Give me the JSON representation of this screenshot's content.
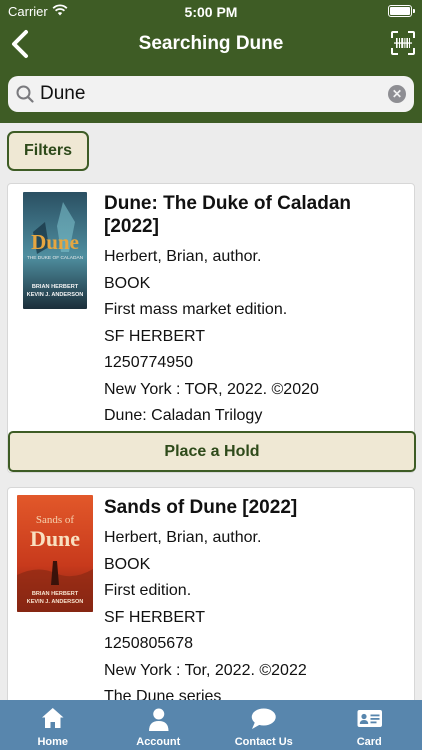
{
  "status_bar": {
    "carrier": "Carrier",
    "time": "5:00 PM"
  },
  "header": {
    "title": "Searching Dune"
  },
  "search": {
    "value": "Dune",
    "placeholder": ""
  },
  "filters_label": "Filters",
  "results": [
    {
      "title": "Dune: The Duke of Caladan [2022]",
      "author": "Herbert, Brian, author.",
      "format": "BOOK",
      "edition": "First mass market edition.",
      "call_number": "SF HERBERT",
      "isbn": "1250774950",
      "publication": "New York : TOR, 2022. ©2020",
      "series": "Dune: Caladan Trilogy",
      "hold_label": "Place a Hold",
      "cover": {
        "title": "Dune",
        "subtitle": "THE DUKE OF CALADAN",
        "authors": [
          "BRIAN HERBERT",
          "KEVIN J. ANDERSON"
        ]
      }
    },
    {
      "title": "Sands of Dune [2022]",
      "author": "Herbert, Brian, author.",
      "format": "BOOK",
      "edition": "First edition.",
      "call_number": "SF HERBERT",
      "isbn": "1250805678",
      "publication": "New York : Tor, 2022. ©2022",
      "series": "The Dune series",
      "cover": {
        "title_top": "Sands of",
        "title": "Dune",
        "authors": [
          "BRIAN HERBERT",
          "KEVIN J. ANDERSON"
        ]
      }
    }
  ],
  "tabs": [
    {
      "label": "Home",
      "icon": "home-icon"
    },
    {
      "label": "Account",
      "icon": "person-icon"
    },
    {
      "label": "Contact Us",
      "icon": "chat-bubble-icon"
    },
    {
      "label": "Card",
      "icon": "id-card-icon"
    }
  ],
  "colors": {
    "header": "#3e5c25",
    "tabbar": "#5886ad",
    "button_fill": "#efe8d4"
  }
}
